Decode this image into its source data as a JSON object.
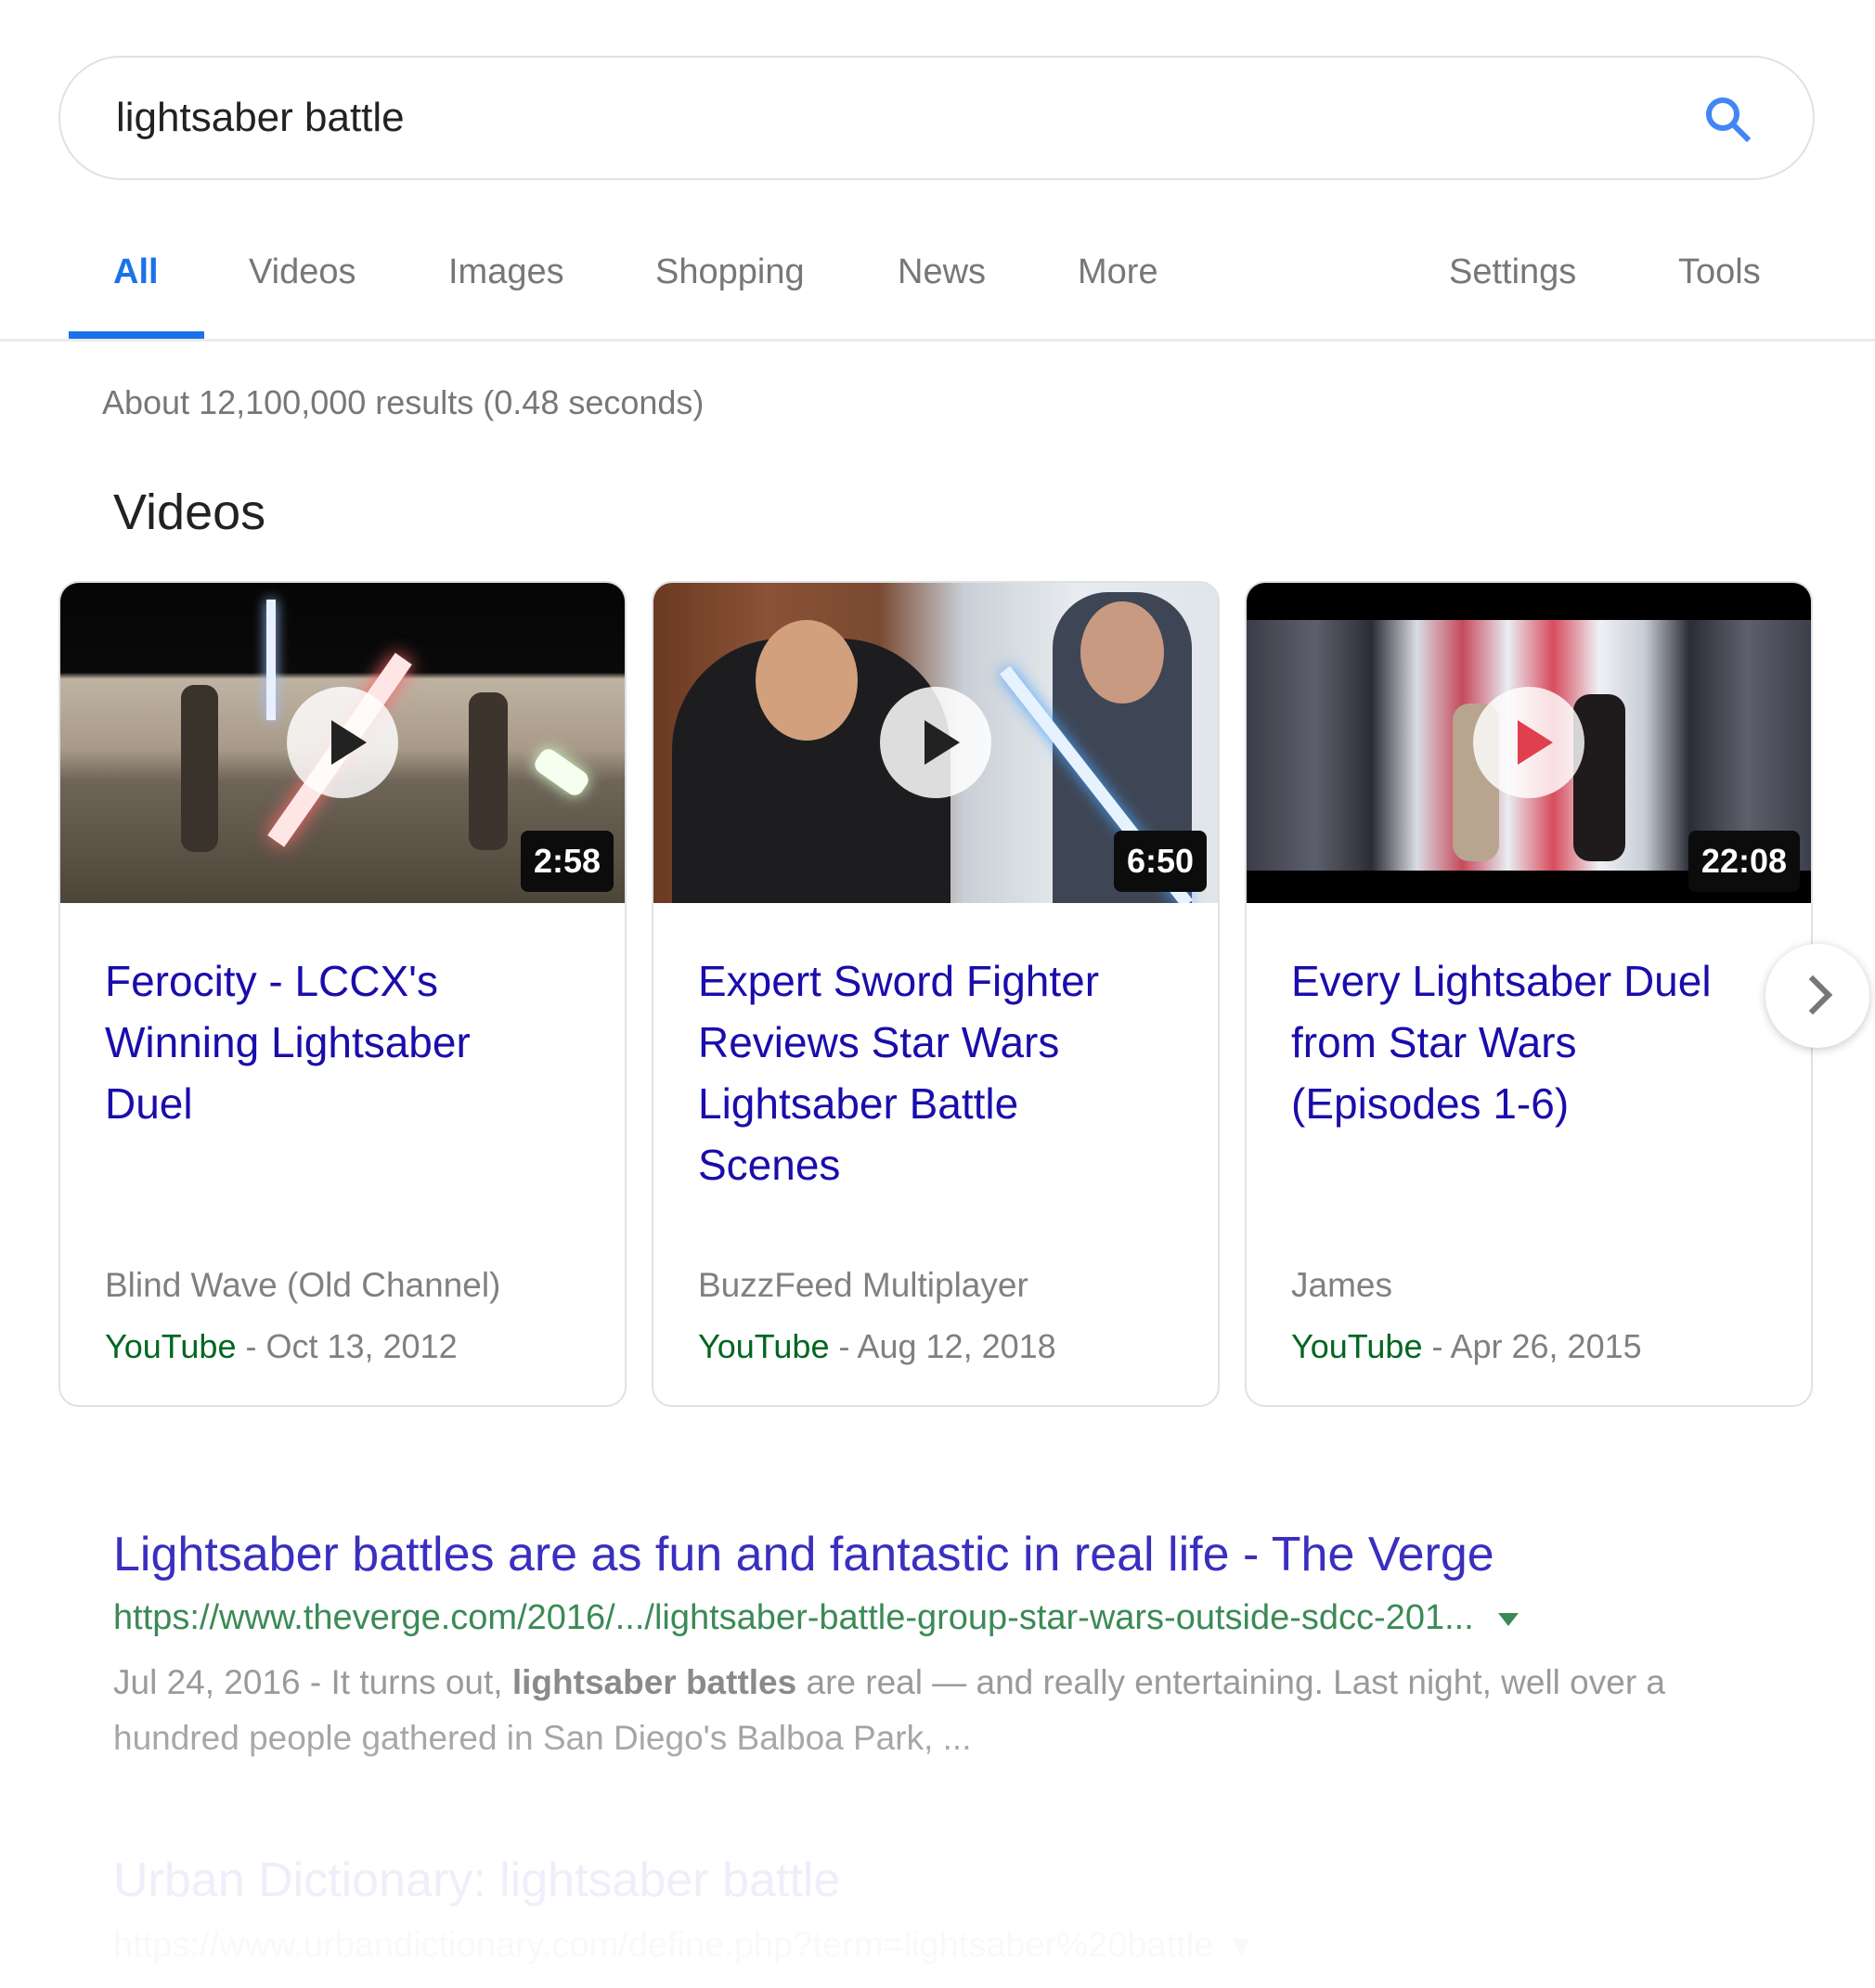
{
  "search": {
    "query": "lightsaber battle",
    "icon": "search-icon",
    "icon_color": "#4285f4"
  },
  "tabs": [
    {
      "label": "All",
      "active": true
    },
    {
      "label": "Videos"
    },
    {
      "label": "Images"
    },
    {
      "label": "Shopping"
    },
    {
      "label": "News"
    },
    {
      "label": "More"
    }
  ],
  "tools": {
    "settings": "Settings",
    "tools": "Tools"
  },
  "stats": "About 12,100,000 results (0.48 seconds)",
  "videos": {
    "section_title": "Videos",
    "next_icon": "chevron-right-icon",
    "cards": [
      {
        "title": "Ferocity - LCCX's Winning Lightsaber Duel",
        "duration": "2:58",
        "channel": "Blind Wave (Old Channel)",
        "source": "YouTube",
        "date": " - Oct 13, 2012"
      },
      {
        "title": "Expert Sword Fighter Reviews Star Wars Lightsaber Battle Scenes",
        "duration": "6:50",
        "channel": "BuzzFeed Multiplayer",
        "source": "YouTube",
        "date": " - Aug 12, 2018"
      },
      {
        "title": "Every Lightsaber Duel from Star Wars (Episodes 1-6)",
        "duration": "22:08",
        "channel": "James",
        "source": "YouTube",
        "date": " - Apr 26, 2015"
      }
    ]
  },
  "results": [
    {
      "title": "Lightsaber battles are as fun and fantastic in real life - The Verge",
      "url": "https://www.theverge.com/2016/.../lightsaber-battle-group-star-wars-outside-sdcc-201...",
      "snippet_date": "Jul 24, 2016 - It turns out, ",
      "snippet_bold": "lightsaber battles",
      "snippet_rest": " are real — and really entertaining. Last night, well over a hundred people gathered in San Diego's Balboa Park, ..."
    },
    {
      "title": "Urban Dictionary: lightsaber battle",
      "url": "https://www.urbandictionary.com/define.php?term=lightsaber%20battle"
    }
  ],
  "colors": {
    "accent": "#1a73e8",
    "link": "#1a0dab",
    "url_green": "#006621",
    "meta_gray": "#808080"
  }
}
